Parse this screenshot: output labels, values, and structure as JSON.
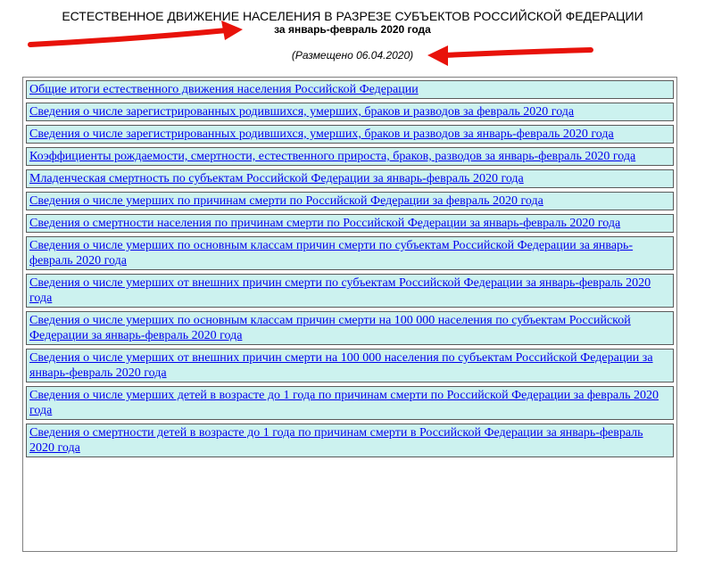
{
  "header": {
    "title": "ЕСТЕСТВЕННОЕ ДВИЖЕНИЕ НАСЕЛЕНИЯ В РАЗРЕЗЕ СУБЪЕКТОВ РОССИЙСКОЙ ФЕДЕРАЦИИ",
    "subtitle": "за январь-февраль 2020 года",
    "posted": "(Размещено 06.04.2020)"
  },
  "colors": {
    "arrow": "#e8120a",
    "cell_bg": "#ccf2ef",
    "link": "#0000ee"
  },
  "links": [
    "Общие итоги естественного движения населения Российской Федерации",
    "Сведения о числе зарегистрированных родившихся, умерших, браков и разводов за февраль 2020 года",
    "Сведения о числе зарегистрированных родившихся, умерших, браков и разводов за январь-февраль 2020 года",
    "Коэффициенты рождаемости, смертности, естественного прироста, браков, разводов за январь-февраль 2020 года",
    "Младенческая смертность по субъектам Российской Федерации за январь-февраль 2020 года",
    "Сведения о числе умерших по причинам смерти по Российской Федерации за февраль 2020 года",
    "Сведения о смертности населения по причинам смерти по Российской Федерации за январь-февраль 2020 года",
    "Сведения о числе умерших по основным классам причин смерти по субъектам Российской Федерации за январь-февраль 2020 года",
    "Сведения о числе умерших от внешних причин смерти по субъектам Российской Федерации за январь-февраль 2020 года",
    "Сведения о числе умерших по основным классам причин смерти на 100 000 населения по субъектам Российской Федерации за январь-февраль 2020 года",
    "Сведения о числе умерших от внешних причин смерти на 100 000 населения по субъектам Российской Федерации за январь-февраль 2020 года",
    "Сведения о числе умерших детей в возрасте до 1 года по причинам смерти по Российской Федерации за февраль 2020 года",
    "Сведения о смертности детей в возрасте до 1 года по причинам смерти в Российской Федерации за январь-февраль 2020 года"
  ]
}
